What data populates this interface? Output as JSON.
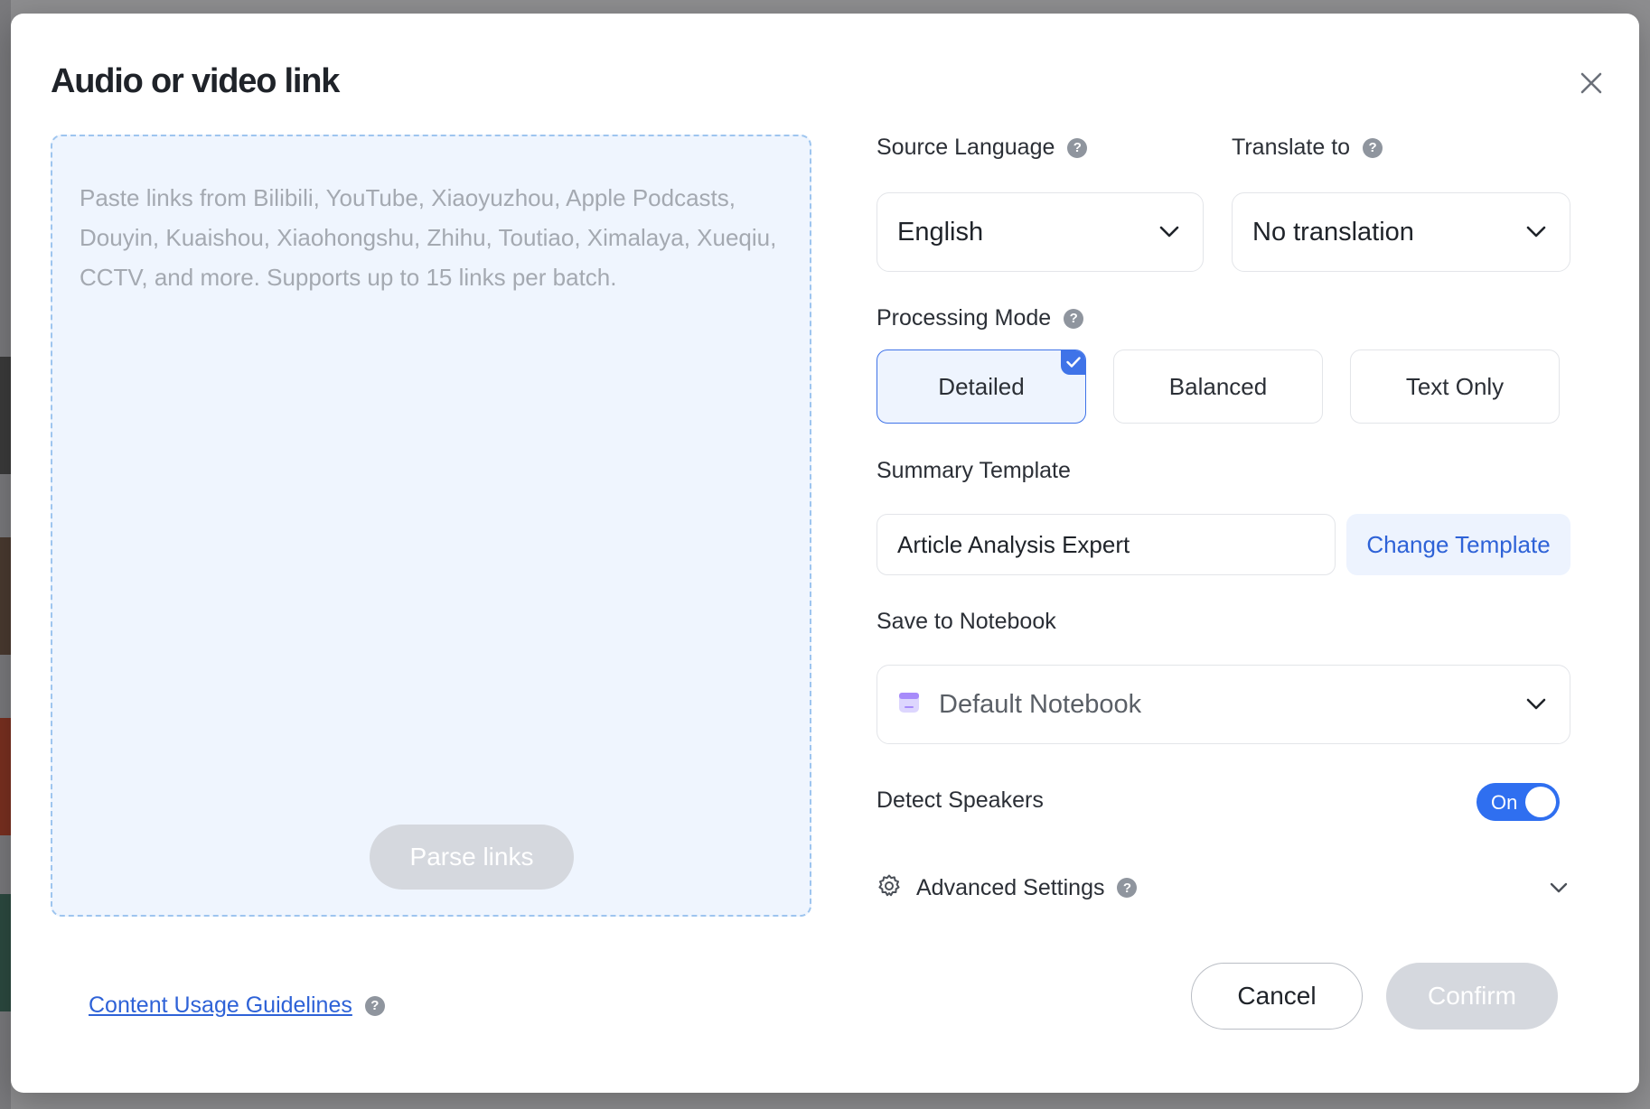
{
  "dialog": {
    "title": "Audio or video link",
    "close_icon": "close-icon"
  },
  "links_input": {
    "value": "",
    "placeholder": "Paste links from Bilibili, YouTube, Xiaoyuzhou, Apple Podcasts, Douyin, Kuaishou, Xiaohongshu, Zhihu, Toutiao, Ximalaya, Xueqiu, CCTV, and more. Supports up to 15 links per batch.",
    "parse_button": "Parse links"
  },
  "source_language": {
    "label": "Source Language",
    "value": "English"
  },
  "translate_to": {
    "label": "Translate to",
    "value": "No translation"
  },
  "processing_mode": {
    "label": "Processing Mode",
    "options": [
      {
        "label": "Detailed",
        "selected": true
      },
      {
        "label": "Balanced",
        "selected": false
      },
      {
        "label": "Text Only",
        "selected": false
      }
    ]
  },
  "summary_template": {
    "label": "Summary Template",
    "value": "Article Analysis Expert",
    "change_button": "Change Template"
  },
  "notebook": {
    "label": "Save to Notebook",
    "value": "Default Notebook",
    "icon": "notebook-icon"
  },
  "detect_speakers": {
    "label": "Detect Speakers",
    "toggle_text": "On",
    "enabled": true
  },
  "advanced": {
    "label": "Advanced Settings",
    "icon": "gear-icon"
  },
  "footer": {
    "guidelines_link": "Content Usage Guidelines",
    "cancel": "Cancel",
    "confirm": "Confirm"
  },
  "colors": {
    "accent": "#3f73e8",
    "link": "#2e62d7",
    "disabled": "#d5d8de",
    "dropzone_bg": "#eff5fe"
  }
}
